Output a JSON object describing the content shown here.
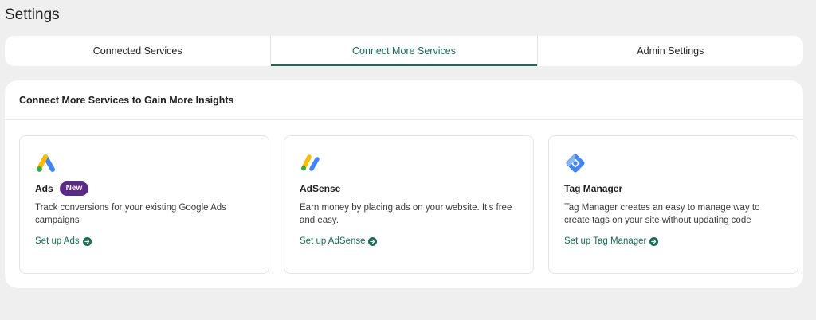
{
  "page": {
    "title": "Settings"
  },
  "tabs": [
    {
      "label": "Connected Services",
      "active": false
    },
    {
      "label": "Connect More Services",
      "active": true
    },
    {
      "label": "Admin Settings",
      "active": false
    }
  ],
  "panel": {
    "heading": "Connect More Services to Gain More Insights",
    "cards": [
      {
        "title": "Ads",
        "badge": "New",
        "description": "Track conversions for your existing Google Ads campaigns",
        "link": "Set up Ads",
        "icon": "google-ads-logo"
      },
      {
        "title": "AdSense",
        "description": "Earn money by placing ads on your website. It’s free and easy.",
        "link": "Set up AdSense",
        "icon": "adsense-logo"
      },
      {
        "title": "Tag Manager",
        "description": "Tag Manager creates an easy to manage way to create tags on your site without updating code",
        "link": "Set up Tag Manager",
        "icon": "tag-manager-logo"
      }
    ]
  },
  "colors": {
    "accent": "#1b6b57",
    "badge": "#5b2a86",
    "background": "#efefef"
  }
}
